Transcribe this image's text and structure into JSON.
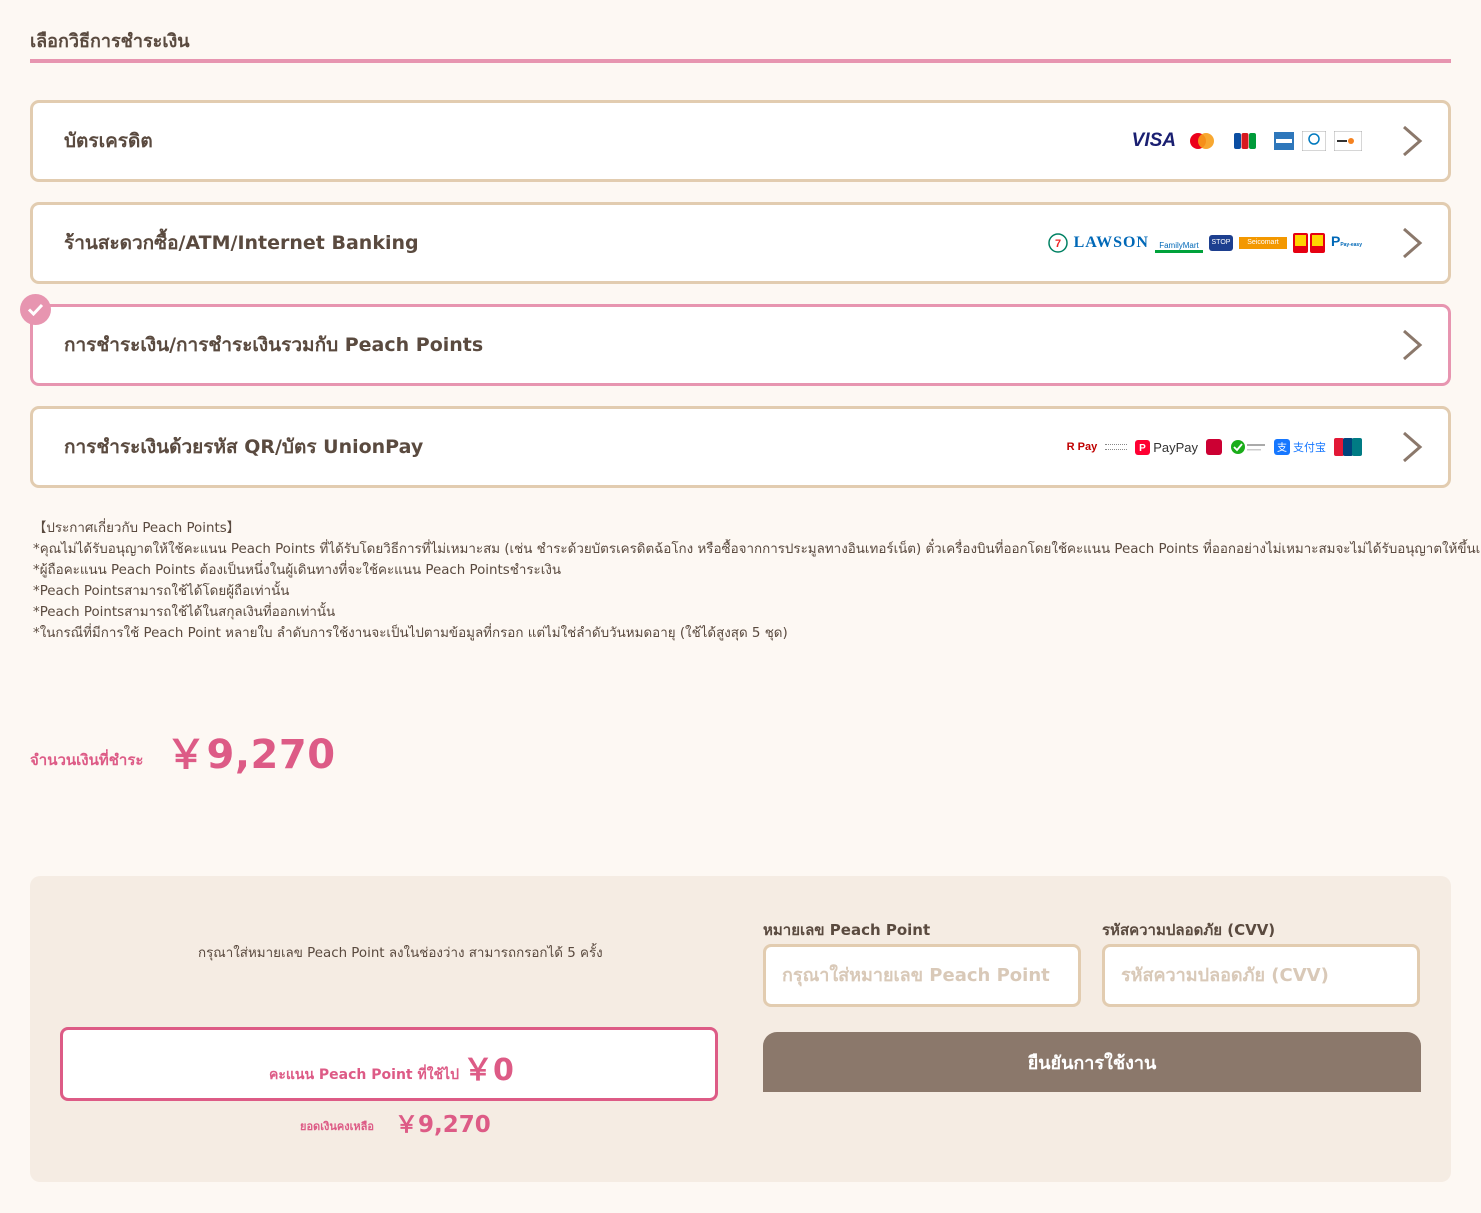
{
  "section": {
    "title": "เลือกวิธีการชำระเงิน"
  },
  "methods": [
    {
      "label": "บัตรเครดิต",
      "logos": [
        "visa",
        "mastercard",
        "jcb",
        "amex",
        "diners",
        "discover"
      ],
      "visa_text": "VISA"
    },
    {
      "label": "ร้านสะดวกซื้อ/ATM/Internet Banking",
      "logos": [
        "seven-eleven",
        "lawson",
        "familymart",
        "ministop",
        "seicomart",
        "daily-yamazaki",
        "pay-easy"
      ],
      "lawson_text": "LAWSON",
      "familymart_text": "FamilyMart",
      "ministop_text": "STOP",
      "seicomart_text": "Seicomart",
      "payeasy_text": "Pay-easy"
    },
    {
      "label": "การชำระเงิน/การชำระเงินรวมกับ Peach Points",
      "selected": true
    },
    {
      "label": "การชำระเงินด้วยรหัส QR/บัตร UnionPay",
      "logos": [
        "rakuten-pay",
        "paypay",
        "d-barai",
        "wechat-pay",
        "alipay",
        "unionpay"
      ],
      "rpay_text": "R Pay",
      "paypay_text": "PayPay",
      "alipay_text": "支付宝"
    }
  ],
  "notes": [
    "【ประกาศเกี่ยวกับ Peach Points】",
    "*คุณไม่ได้รับอนุญาตให้ใช้คะแนน Peach Points ที่ได้รับโดยวิธีการที่ไม่เหมาะสม (เช่น ชำระด้วยบัตรเครดิตฉ้อโกง หรือซื้อจากการประมูลทางอินเทอร์เน็ต) ตั๋วเครื่องบินที่ออกโดยใช้คะแนน Peach Points ที่ออกอย่างไม่เหมาะสมจะไม่ได้รับอนุญาตให้ขึ้นเครื่อง\"",
    "*ผู้ถือคะแนน Peach Points ต้องเป็นหนึ่งในผู้เดินทางที่จะใช้คะแนน Peach Pointsชำระเงิน",
    "*Peach Pointsสามารถใช้ได้โดยผู้ถือเท่านั้น",
    "*Peach Pointsสามารถใช้ได้ในสกุลเงินที่ออกเท่านั้น",
    "*ในกรณีที่มีการใช้ Peach Point หลายใบ ลำดับการใช้งานจะเป็นไปตามข้อมูลที่กรอก แต่ไม่ใช่ลำดับวันหมดอายุ (ใช้ได้สูงสุด 5 ชุด)"
  ],
  "amount": {
    "label": "จำนวนเงินที่ชำระ",
    "value": "￥9,270"
  },
  "points": {
    "hint": "กรุณาใส่หมายเลข Peach Point ลงในช่องว่าง สามารถกรอกได้ 5 ครั้ง",
    "used_label": "คะแนน Peach Point ที่ใช้ไป",
    "used_value": "￥0",
    "remaining_label": "ยอดเงินคงเหลือ",
    "remaining_value": "￥9,270",
    "number_label": "หมายเลข Peach Point",
    "number_placeholder": "กรุณาใส่หมายเลข Peach Point",
    "cvv_label": "รหัสความปลอดภัย (CVV)",
    "cvv_placeholder": "รหัสความปลอดภัย (CVV)",
    "confirm_label": "ยืนยันการใช้งาน"
  },
  "colors": {
    "accent_pink": "#dd5b86",
    "rule_pink": "#e795b0",
    "border_tan": "#e2ccb0",
    "button_brown": "#8b786b",
    "panel_bg": "#f5ece3"
  }
}
